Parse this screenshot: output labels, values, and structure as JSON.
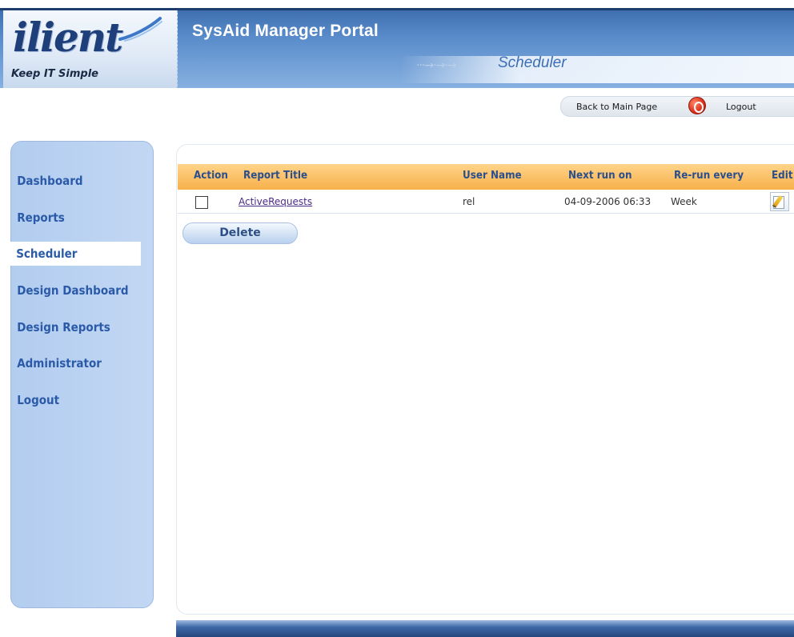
{
  "header": {
    "logo_text": "ilient",
    "tagline": "Keep IT Simple",
    "portal_title": "SysAid Manager Portal",
    "page_subtitle": "Scheduler",
    "crumb_arrows": "···→·→·→"
  },
  "toplinks": {
    "back": "Back to Main Page",
    "logout": "Logout"
  },
  "sidebar": {
    "items": [
      {
        "label": "Dashboard"
      },
      {
        "label": "Reports"
      },
      {
        "label": "Scheduler",
        "active": true
      },
      {
        "label": "Design Dashboard"
      },
      {
        "label": "Design Reports"
      },
      {
        "label": "Administrator"
      },
      {
        "label": "Logout"
      }
    ]
  },
  "table": {
    "columns": [
      "Action",
      "Report Title",
      "User Name",
      "Next run on",
      "Re-run every",
      "Edit"
    ],
    "rows": [
      {
        "checked": false,
        "title": "ActiveRequests",
        "user": "rel",
        "next_run": "04-09-2006 06:33",
        "rerun": "Week"
      }
    ]
  },
  "actions": {
    "delete_label": "Delete"
  },
  "colors": {
    "banner": "#4f80c0",
    "header_row": "#f7b04a",
    "sidebar": "#b3cdf0",
    "nav_text": "#2a5aa8",
    "link": "#4a2a86"
  },
  "icons": {
    "logout": "power-icon",
    "edit": "edit-pencil-icon"
  }
}
